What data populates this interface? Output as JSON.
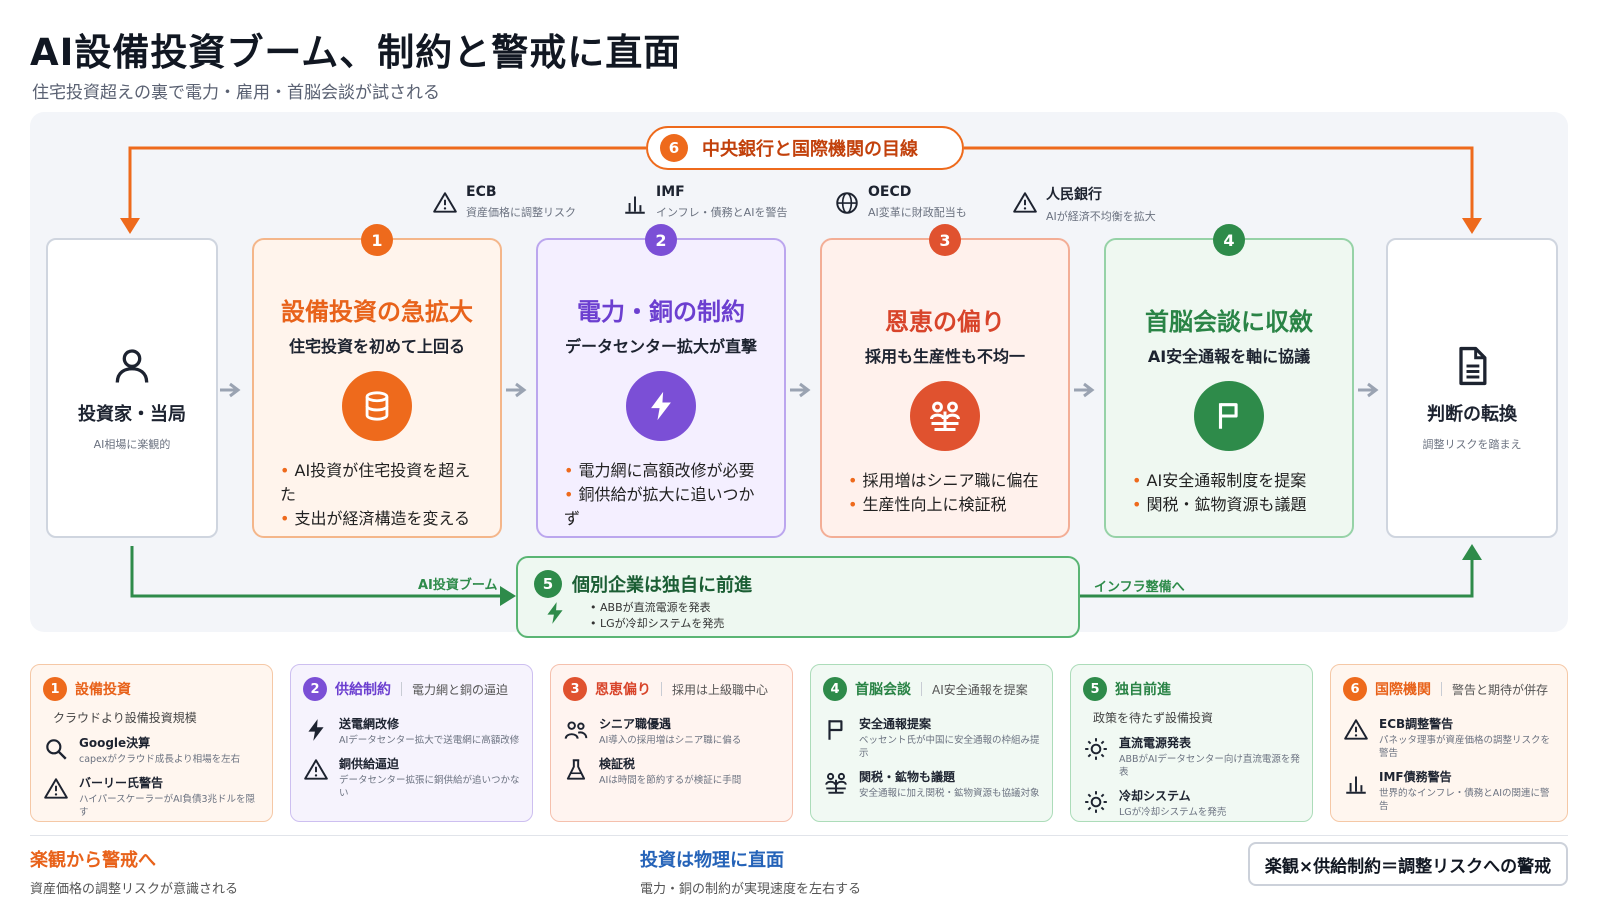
{
  "header": {
    "title": "AI設備投資ブーム、制約と警戒に直面",
    "subtitle": "住宅投資超えの裏で電力・雇用・首脳会談が試される"
  },
  "colors": {
    "orange": "#ee6a1c",
    "purple": "#7b4fd6",
    "red": "#e0522f",
    "green": "#2e8b4a",
    "gray": "#1d2330"
  },
  "top_banner": {
    "num": "6",
    "label": "中央銀行と国際機関の目線"
  },
  "institutions": [
    {
      "name": "ECB",
      "desc": "資産価格に調整リスク",
      "icon": "warning-icon"
    },
    {
      "name": "IMF",
      "desc": "インフレ・債務とAIを警告",
      "icon": "bar-chart-icon"
    },
    {
      "name": "OECD",
      "desc": "AI変革に財政配当も",
      "icon": "globe-icon"
    },
    {
      "name": "人民銀行",
      "desc": "AIが経済不均衡を拡大",
      "icon": "warning-icon"
    }
  ],
  "start": {
    "title": "投資家・当局",
    "sub": "AI相場に楽観的",
    "icon": "user-icon"
  },
  "end": {
    "title": "判断の転換",
    "sub": "調整リスクを踏まえ",
    "icon": "document-icon"
  },
  "cards": [
    {
      "num": "1",
      "title": "設備投資の急拡大",
      "sub": "住宅投資を初めて上回る",
      "icon": "database-icon",
      "bullets": [
        "AI投資が住宅投資を超えた",
        "支出が経済構造を変える"
      ]
    },
    {
      "num": "2",
      "title": "電力・銅の制約",
      "sub": "データセンター拡大が直撃",
      "icon": "bolt-icon",
      "bullets": [
        "電力網に高額改修が必要",
        "銅供給が拡大に追いつかず"
      ]
    },
    {
      "num": "3",
      "title": "恩恵の偏り",
      "sub": "採用も生産性も不均一",
      "icon": "people-icon",
      "bullets": [
        "採用増はシニア職に偏在",
        "生産性向上に検証税"
      ]
    },
    {
      "num": "4",
      "title": "首脳会談に収斂",
      "sub": "AI安全通報を軸に協議",
      "icon": "flag-icon",
      "bullets": [
        "AI安全通報制度を提案",
        "関税・鉱物資源も議題"
      ]
    }
  ],
  "box5": {
    "num": "5",
    "title": "個別企業は独自に前進",
    "icon": "bolt-icon",
    "bullets": [
      "ABBが直流電源を発表",
      "LGが冷却システムを発売"
    ]
  },
  "flow_labels": {
    "left": "AI投資ブーム",
    "right": "インフラ整備へ"
  },
  "legend": [
    {
      "num": "1",
      "title": "設備投資",
      "sub": "",
      "lead": "クラウドより設備投資規模",
      "items": [
        {
          "icon": "search-icon",
          "name": "Google決算",
          "desc": "capexがクラウド成長より相場を左右"
        },
        {
          "icon": "warning-icon",
          "name": "バーリー氏警告",
          "desc": "ハイパースケーラーがAI負債3兆ドルを隠す"
        }
      ]
    },
    {
      "num": "2",
      "title": "供給制約",
      "sub": "電力網と銅の逼迫",
      "lead": "",
      "items": [
        {
          "icon": "bolt-icon",
          "name": "送電網改修",
          "desc": "AIデータセンター拡大で送電網に高額改修"
        },
        {
          "icon": "warning-icon",
          "name": "銅供給逼迫",
          "desc": "データセンター拡張に銅供給が追いつかない"
        }
      ]
    },
    {
      "num": "3",
      "title": "恩恵偏り",
      "sub": "採用は上級職中心",
      "lead": "",
      "items": [
        {
          "icon": "people-icon",
          "name": "シニア職優遇",
          "desc": "AI導入の採用増はシニア職に偏る"
        },
        {
          "icon": "flask-icon",
          "name": "検証税",
          "desc": "AIは時間を節約するが検証に手間"
        }
      ]
    },
    {
      "num": "4",
      "title": "首脳会談",
      "sub": "AI安全通報を提案",
      "lead": "",
      "items": [
        {
          "icon": "flag-icon",
          "name": "安全通報提案",
          "desc": "ベッセント氏が中国に安全通報の枠組み提示"
        },
        {
          "icon": "people-icon",
          "name": "関税・鉱物も議題",
          "desc": "安全通報に加え関税・鉱物資源も協議対象"
        }
      ]
    },
    {
      "num": "5",
      "title": "独自前進",
      "sub": "",
      "lead": "政策を待たず設備投資",
      "items": [
        {
          "icon": "sun-icon",
          "name": "直流電源発表",
          "desc": "ABBがAIデータセンター向け直流電源を発表"
        },
        {
          "icon": "sun-icon",
          "name": "冷却システム",
          "desc": "LGが冷却システムを発売"
        }
      ]
    },
    {
      "num": "6",
      "title": "国際機関",
      "sub": "警告と期待が併存",
      "lead": "",
      "items": [
        {
          "icon": "warning-icon",
          "name": "ECB調整警告",
          "desc": "パネッタ理事が資産価格の調整リスクを警告"
        },
        {
          "icon": "bar-chart-icon",
          "name": "IMF債務警告",
          "desc": "世界的なインフレ・債務とAIの関連に警告"
        }
      ]
    }
  ],
  "footer": [
    {
      "title": "楽観から警戒へ",
      "sub": "資産価格の調整リスクが意識される"
    },
    {
      "title": "投資は物理に直面",
      "sub": "電力・銅の制約が実現速度を左右する"
    }
  ],
  "callout": "楽観×供給制約＝調整リスクへの警戒"
}
